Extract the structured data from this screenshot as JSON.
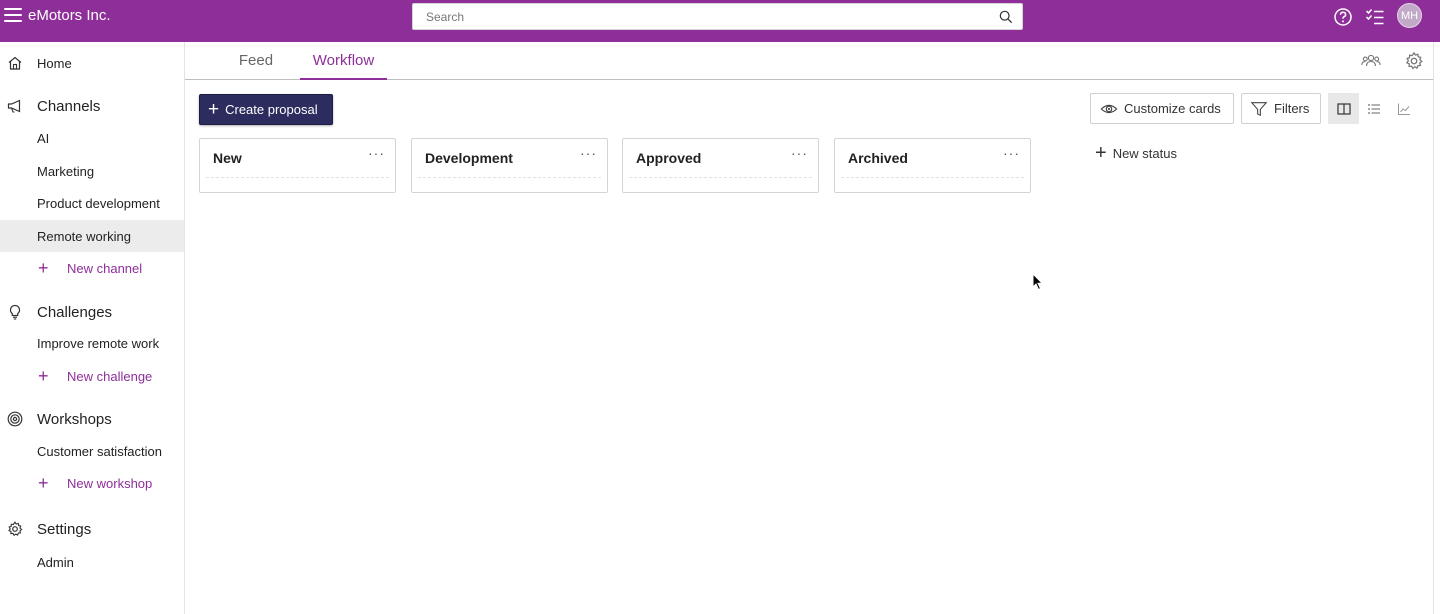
{
  "app": {
    "title": "eMotors Inc."
  },
  "search": {
    "placeholder": "Search",
    "value": ""
  },
  "topbar": {
    "avatar_initials": "MH",
    "icons": [
      "menu-icon",
      "search-icon",
      "help-icon",
      "tasks-icon"
    ]
  },
  "sidebar": {
    "home": {
      "label": "Home",
      "icon": "home-icon"
    },
    "channels": {
      "label": "Channels",
      "icon": "megaphone-icon",
      "items": [
        {
          "label": "AI"
        },
        {
          "label": "Marketing"
        },
        {
          "label": "Product development"
        },
        {
          "label": "Remote working",
          "active": true
        }
      ],
      "new_label": "New channel"
    },
    "challenges": {
      "label": "Challenges",
      "icon": "lightbulb-icon",
      "items": [
        {
          "label": "Improve remote work"
        }
      ],
      "new_label": "New challenge"
    },
    "workshops": {
      "label": "Workshops",
      "icon": "target-icon",
      "items": [
        {
          "label": "Customer satisfaction"
        }
      ],
      "new_label": "New workshop"
    },
    "settings": {
      "label": "Settings",
      "icon": "gear-icon",
      "items": [
        {
          "label": "Admin"
        }
      ]
    }
  },
  "tabs": [
    {
      "label": "Feed",
      "active": false
    },
    {
      "label": "Workflow",
      "active": true
    }
  ],
  "toolbar": {
    "create_label": "Create proposal",
    "customize_label": "Customize cards",
    "filters_label": "Filters",
    "views": [
      "board-view-icon",
      "list-view-icon",
      "chart-view-icon"
    ],
    "active_view": "board-view-icon"
  },
  "columns": [
    {
      "title": "New"
    },
    {
      "title": "Development"
    },
    {
      "title": "Approved"
    },
    {
      "title": "Archived"
    }
  ],
  "new_status_label": "New status",
  "colors": {
    "brand": "#8e2f99",
    "primary_button": "#2c2c5e",
    "active_item_bg": "#ececec"
  }
}
